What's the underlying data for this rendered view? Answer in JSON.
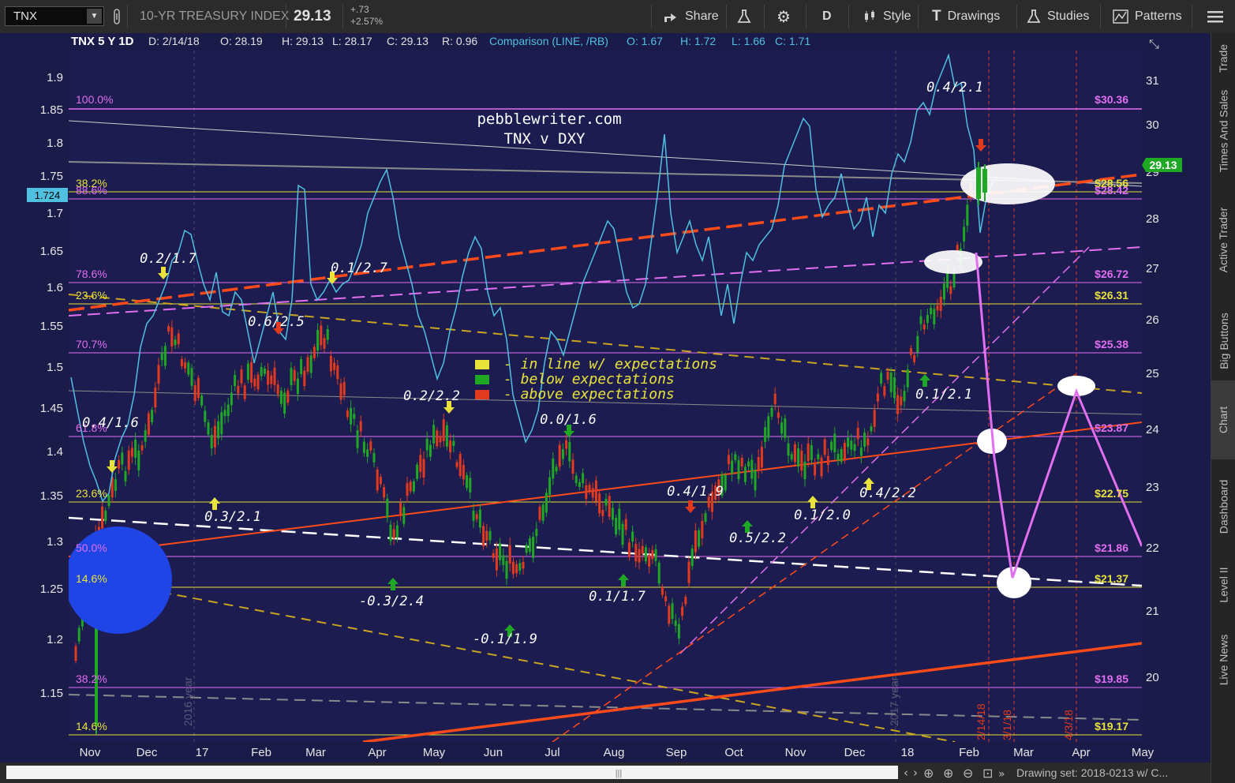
{
  "toolbar": {
    "symbol": "TNX",
    "name": "10-YR TREASURY INDEX",
    "last": "29.13",
    "change": "+.73",
    "change_pct": "+2.57%",
    "share_label": "Share",
    "period_label": "D",
    "style_label": "Style",
    "drawings_label": "Drawings",
    "studies_label": "Studies",
    "patterns_label": "Patterns"
  },
  "header": {
    "title": "TNX 5 Y 1D",
    "date": "D: 2/14/18",
    "open": "O: 28.19",
    "high": "H: 29.13",
    "low": "L: 28.17",
    "close": "C: 29.13",
    "range": "R: 0.96",
    "comparison": "Comparison (LINE, /RB)",
    "cmp_open": "O: 1.67",
    "cmp_high": "H: 1.72",
    "cmp_low": "L: 1.66",
    "cmp_close": "C: 1.71"
  },
  "colors": {
    "background": "#1b1b4a",
    "up": "#1fa824",
    "down": "#e23a1e",
    "comparison": "#4fc0e0",
    "fib_line": "#e26ef0",
    "fib_yellow": "#e8e23a",
    "trend_orange": "#ff4a1a"
  },
  "chart_data": {
    "type": "line",
    "title": "pebblewriter.com",
    "subtitle": "TNX v DXY",
    "left_axis": [
      "1.9",
      "1.85",
      "1.8",
      "1.75",
      "1.7",
      "1.65",
      "1.6",
      "1.55",
      "1.5",
      "1.45",
      "1.4",
      "1.35",
      "1.3",
      "1.25",
      "1.2",
      "1.15"
    ],
    "right_axis": [
      "31",
      "30",
      "29",
      "28",
      "27",
      "26",
      "25",
      "24",
      "23",
      "22",
      "21",
      "20"
    ],
    "x_axis": [
      "Nov",
      "Dec",
      "17",
      "Feb",
      "Mar",
      "Apr",
      "May",
      "Jun",
      "Jul",
      "Aug",
      "Sep",
      "Oct",
      "Nov",
      "Dec",
      "18",
      "Feb",
      "Mar",
      "Apr",
      "May"
    ],
    "left_marker": "1.724",
    "last_marker": "29.13",
    "year_labels": [
      "2016 year",
      "2017 year"
    ],
    "date_labels": [
      "2/14/18",
      "3/1/18",
      "4/3/18"
    ],
    "fib_left": [
      "100.0%",
      "38.2%",
      "88.6%",
      "78.6%",
      "23.6%",
      "70.7%",
      "61.8%",
      "23.6%",
      "50.0%",
      "14.6%",
      "38.2%",
      "14.6%"
    ],
    "fib_right": [
      "$30.36",
      "$28.56",
      "$28.42",
      "$26.72",
      "$26.31",
      "$25.38",
      "$23.87",
      "$22.75",
      "$21.86",
      "$21.37",
      "$19.85",
      "$19.17"
    ],
    "annotations": [
      "0.4/2.1",
      "0.2/1.7",
      "0.1/2.7",
      "0.6/2.5",
      "0.2/2.2",
      "0.0/1.6",
      "0.4/1.6",
      "0.3/2.1",
      "-0.3/2.4",
      "-0.1/1.9",
      "0.1/1.7",
      "0.4/1.9",
      "0.5/2.2",
      "0.1/2.0",
      "0.4/2.2",
      "0.1/2.1"
    ],
    "legend": [
      "- in line w/ expectations",
      "- below expectations",
      "- above expectations"
    ]
  },
  "bottom": {
    "drawing_set": "Drawing set: 2018-0213 w/ C..."
  },
  "sidebar": {
    "items": [
      "Trade",
      "Times And Sales",
      "Active Trader",
      "Big Buttons",
      "Chart",
      "Dashboard",
      "Level II",
      "Live News"
    ]
  }
}
